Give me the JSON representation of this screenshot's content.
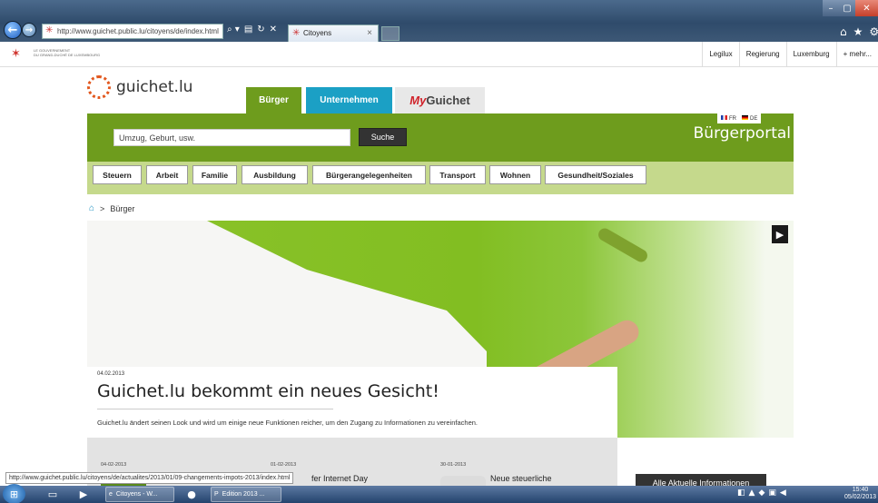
{
  "browser": {
    "address": "http://www.guichet.public.lu/citoyens/de/index.html",
    "tab_title": "Citoyens",
    "address_controls": [
      "⌕ ▾",
      "▤",
      "↻",
      "✕"
    ],
    "tool_icons": [
      "⌂",
      "★",
      "⚙"
    ]
  },
  "govbar": {
    "text_line1": "LE GOUVERNEMENT",
    "text_line2": "DU GRAND-DUCHÉ DE LUXEMBOURG",
    "links": [
      "Legilux",
      "Regierung",
      "Luxemburg",
      "+ mehr..."
    ]
  },
  "site": {
    "logo_text": "guichet.lu",
    "tabs": {
      "buerger": "Bürger",
      "unternehmen": "Unternehmen",
      "my_prefix": "My",
      "my_suffix": "Guichet"
    },
    "search_placeholder": "Umzug, Geburt, usw.",
    "search_button": "Suche",
    "lang_fr": "FR",
    "lang_de": "DE",
    "portal_title": "Bürgerportal",
    "categories": [
      "Steuern",
      "Arbeit",
      "Familie",
      "Ausbildung",
      "Bürgerangelegenheiten",
      "Transport",
      "Wohnen",
      "Gesundheit/Soziales"
    ],
    "breadcrumb": "Bürger"
  },
  "hero": {
    "date": "04.02.2013",
    "title": "Guichet.lu bekommt ein neues Gesicht!",
    "text": "Guichet.lu ändert seinen Look und wird um einige neue Funktionen reicher, um den Zugang zu Informationen zu vereinfachen."
  },
  "news": [
    {
      "date": "04-02-2013",
      "title": ""
    },
    {
      "date": "01-02-2013",
      "title": "fer Internet Day"
    },
    {
      "date": "30-01-2013",
      "title": "Neue steuerliche"
    }
  ],
  "alle_button": "Alle Aktuelle Informationen",
  "status_url": "http://www.guichet.public.lu/citoyens/de/actualites/2013/01/09-changements-impots-2013/index.html",
  "taskbar": {
    "ie_label": "Citoyens - W...",
    "pub_label": "Edition 2013 ...",
    "time": "15:40",
    "date": "05/02/2013"
  },
  "colors": {
    "primary_green": "#6e9c1d",
    "light_green": "#c5d98c",
    "blue_tab": "#1ba0c5"
  }
}
